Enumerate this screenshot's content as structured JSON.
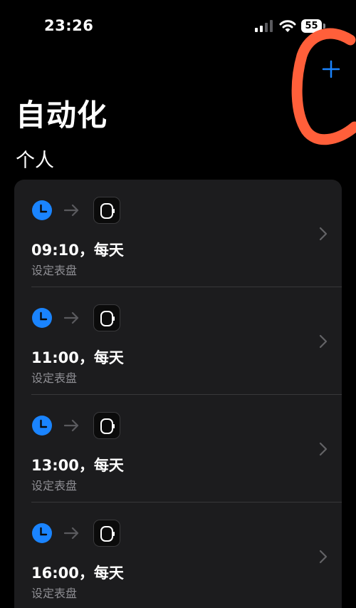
{
  "status_bar": {
    "time": "23:26",
    "battery": "55"
  },
  "header": {
    "title": "自动化",
    "section": "个人"
  },
  "automations": [
    {
      "title": "09:10，每天",
      "subtitle": "设定表盘"
    },
    {
      "title": "11:00，每天",
      "subtitle": "设定表盘"
    },
    {
      "title": "13:00，每天",
      "subtitle": "设定表盘"
    },
    {
      "title": "16:00，每天",
      "subtitle": "设定表盘"
    }
  ],
  "colors": {
    "accent": "#1a84ff",
    "card": "#1c1c1e",
    "secondary_text": "#8e8e93",
    "annotation": "#ff5f3a"
  },
  "icons": {
    "trigger": "clock-icon",
    "connector": "arrow-right-icon",
    "action": "watch-icon",
    "disclosure": "chevron-right-icon",
    "add": "plus-icon"
  }
}
